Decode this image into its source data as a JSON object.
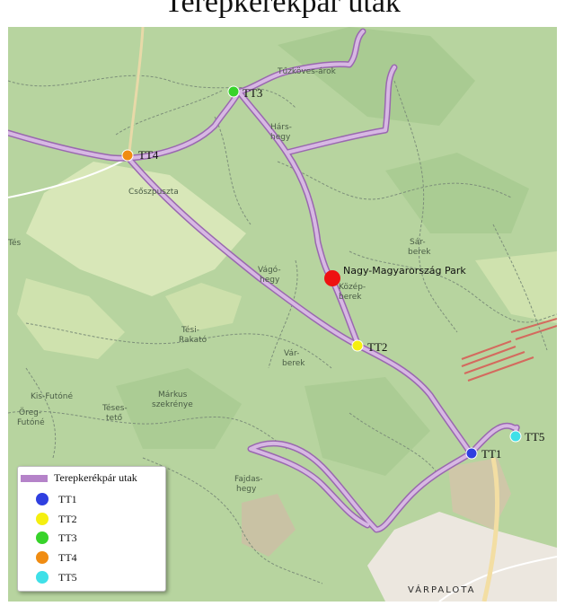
{
  "title": "Terepkerékpár utak",
  "points": [
    {
      "id": "TT1",
      "label": "TT1",
      "color": "#2f3fe0"
    },
    {
      "id": "TT2",
      "label": "TT2",
      "color": "#f5ef10"
    },
    {
      "id": "TT3",
      "label": "TT3",
      "color": "#37d32a"
    },
    {
      "id": "TT4",
      "label": "TT4",
      "color": "#f08c12"
    },
    {
      "id": "TT5",
      "label": "TT5",
      "color": "#3fe0e8"
    }
  ],
  "park": {
    "label": "Nagy-Magyarország Park",
    "color": "#ee1111"
  },
  "route_color": "#b583c9",
  "places": {
    "tuzkoves": "Tűzköves-árok",
    "hars1": "Hárs-",
    "hars2": "hegy",
    "csoszpuszta": "Csőszpuszta",
    "tes": "Tés",
    "sar1": "Sár-",
    "sar2": "berek",
    "vago1": "Vágó-",
    "vago2": "hegy",
    "kozep1": "Közép-",
    "kozep2": "berek",
    "tesirakato1": "Tési-",
    "tesirakato2": "Rakató",
    "var1": "Vár-",
    "var2": "berek",
    "kisfutone": "Kis-Futóné",
    "markus1": "Márkus",
    "markus2": "szekrénye",
    "tesesteto1": "Téses-",
    "tesesteto2": "tető",
    "oregfutone1": "Öreg-",
    "oregfutone2": "Futóné",
    "fajdas1": "Fajdas-",
    "fajdas2": "hegy",
    "varpalota": "VÁRPALOTA"
  },
  "legend": {
    "route_label": "Terepkerékpár utak",
    "items": [
      "TT1",
      "TT2",
      "TT3",
      "TT4",
      "TT5"
    ]
  }
}
